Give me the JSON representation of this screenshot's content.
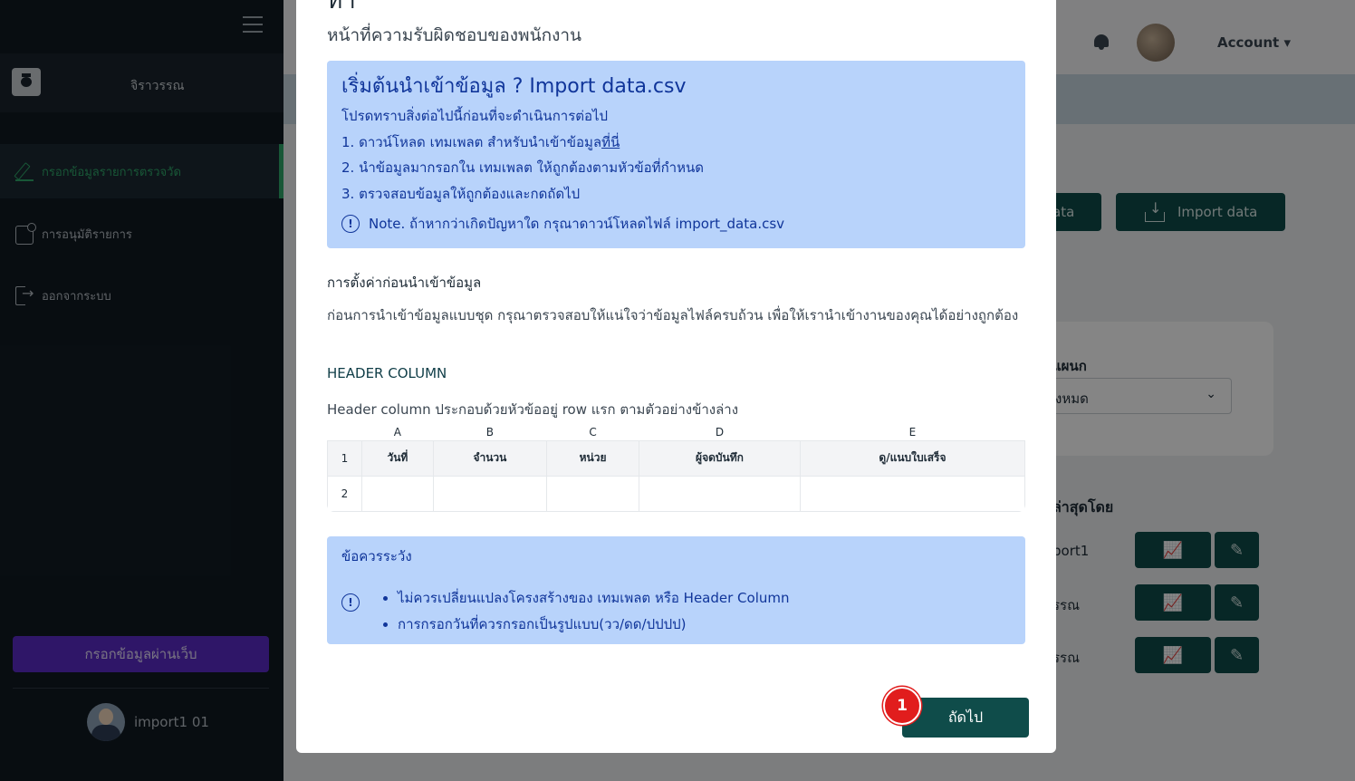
{
  "sidebar": {
    "company_name": "จิราวรรณ",
    "items": [
      {
        "label": "กรอกข้อมูลรายการตรวจวัด",
        "icon": "pencil-icon",
        "active": true
      },
      {
        "label": "การอนุมัติรายการ",
        "icon": "approve-icon",
        "active": false
      },
      {
        "label": "ออกจากระบบ",
        "icon": "logout-icon",
        "active": false
      }
    ],
    "web_button": "กรอกข้อมูลผ่านเว็บ",
    "user_name": "import1 01"
  },
  "topbar": {
    "account": "Account ▾"
  },
  "background": {
    "btn_data": "ata",
    "btn_import": "Import data",
    "dept_label": "แผนก",
    "dept_value": "ั้งหมด",
    "latest_label": "ล่าสุดโดย",
    "rows": [
      "port1",
      "รรณ",
      "รรณ"
    ]
  },
  "modal": {
    "title_partial": "ทำ",
    "subtitle": "หน้าที่ความรับผิดชอบของพนักงาน",
    "info": {
      "heading": "เริ่มต้นนำเข้าข้อมูล ? Import data.csv",
      "intro": "โปรดทราบสิ่งต่อไปนี้ก่อนที่จะดำเนินการต่อไป",
      "step1": "1. ดาวน์โหลด เทมเพลต สำหรับนำเข้าข้อมูล",
      "step1_link": "ที่นี่",
      "step2": "2. นำข้อมูลมากรอกใน เทมเพลต ให้ถูกต้องตามหัวข้อที่กำหนด",
      "step3": "3. ตรวจสอบข้อมูลให้ถูกต้องและกดถัดไป",
      "note": "Note. ถ้าหากว่าเกิดปัญหาใด กรุณาดาวน์โหลดไฟล์ import_data.csv"
    },
    "settings_title": "การตั้งค่าก่อนนำเข้าข้อมูล",
    "settings_desc": "ก่อนการนำเข้าข้อมูลแบบชุด กรุณาตรวจสอบให้แน่ใจว่าข้อมูลไฟล์ครบถ้วน เพื่อให้เรานำเข้างานของคุณได้อย่างถูกต้อง",
    "header_column_title": "HEADER COLUMN",
    "header_column_desc": "Header column ประกอบด้วยหัวข้ออยู่ row แรก ตามตัวอย่างข้างล่าง",
    "sheet": {
      "letters": [
        "A",
        "B",
        "C",
        "D",
        "E"
      ],
      "row1_num": "1",
      "row1": [
        "วันที่",
        "จำนวน",
        "หน่วย",
        "ผู้จดบันทึก",
        "ดู/แนบใบเสร็จ"
      ],
      "row2_num": "2"
    },
    "warning": {
      "heading": "ข้อควรระวัง",
      "items": [
        "ไม่ควรเปลี่ยนแปลงโครงสร้างของ เทมเพลต หรือ Header Column",
        "การกรอกวันที่ควรกรอกเป็นรูปแบบ(วว/ดด/ปปปป)"
      ]
    },
    "next_button": "ถัดไป",
    "step_badge": "1"
  },
  "colors": {
    "sidebar_bg": "#111a22",
    "accent_green": "#2fa76a",
    "primary_teal": "#0f4c4a",
    "info_bg": "#b8d3fb",
    "info_text": "#10359a",
    "web_button": "#5b2bc7",
    "badge_red": "#e11d1d"
  }
}
